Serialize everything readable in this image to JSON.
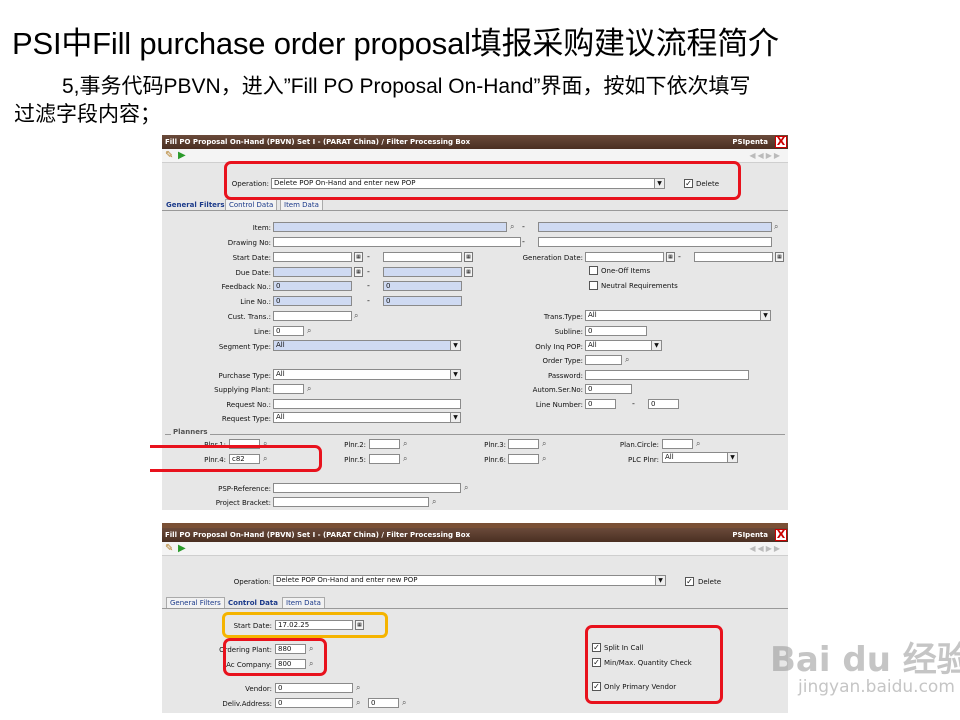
{
  "slide": {
    "title": "PSI中Fill purchase order proposal填报采购建议流程简介",
    "line1": "5,事务代码PBVN，进入”Fill PO Proposal On-Hand”界面，按如下依次填写",
    "line2": "过滤字段内容；"
  },
  "colors": {
    "titlebar": "#5a3a2a",
    "highlight_red": "#e8121d",
    "highlight_orange": "#f5b400",
    "field_blue": "#cfdaf2",
    "tab_text": "#1b3a8a"
  },
  "icons": {
    "wand": "magic-wand-icon",
    "run": "execute-play-icon",
    "close": "close-x-icon",
    "search": "magnifier-icon",
    "calendar": "calendar-icon"
  },
  "window": {
    "title": "Fill PO Proposal On-Hand  (PBVN)  Set I - (PARAT China) / Filter Processing Box",
    "brand": "PSIpenta",
    "close": "X"
  },
  "screen1": {
    "operation_label": "Operation:",
    "operation_value": "Delete POP On-Hand and enter new POP",
    "delete_label": "Delete",
    "delete_checked": true,
    "tabs": [
      "General Filters",
      "Control Data",
      "Item Data"
    ],
    "left": {
      "item": "Item:",
      "drawing_no": "Drawing No:",
      "start_date": "Start Date:",
      "due_date": "Due Date:",
      "feedback_no": "Feedback No.:",
      "feedback_from": "0",
      "feedback_to": "0",
      "line_no": "Line No.:",
      "line_from": "0",
      "line_to": "0",
      "cust_trans": "Cust. Trans.:",
      "line": "Line:",
      "line_value": "0",
      "segment_type": "Segment Type:",
      "segment_value": "All",
      "purchase_type": "Purchase Type:",
      "purchase_value": "All",
      "supplying_plant": "Supplying Plant:",
      "request_no": "Request No.:",
      "request_type": "Request Type:",
      "request_type_value": "All"
    },
    "right": {
      "generation_date": "Generation Date:",
      "one_off": "One-Off Items",
      "neutral": "Neutral Requirements",
      "trans_type": "Trans.Type:",
      "trans_type_value": "All",
      "subline": "Subline:",
      "subline_value": "0",
      "only_inq": "Only Inq POP:",
      "only_inq_value": "All",
      "order_type": "Order Type:",
      "password": "Password:",
      "autom_ser": "Autom.Ser.No:",
      "autom_ser_value": "0",
      "line_number": "Line Number:",
      "line_number_from": "0",
      "line_number_to": "0"
    },
    "planners": {
      "legend": "Planners",
      "plnr1": "Plnr.1:",
      "plnr2": "Plnr.2:",
      "plnr3": "Plnr.3:",
      "plnr4": "Plnr.4:",
      "plnr4_value": "c82",
      "plnr5": "Plnr.5:",
      "plnr6": "Plnr.6:",
      "plan_circle": "Plan.Circle:",
      "plc_plnr": "PLC Plnr:",
      "plc_value": "All"
    },
    "psp_reference": "PSP-Reference:",
    "project_bracket": "Project Bracket:"
  },
  "screen2": {
    "operation_label": "Operation:",
    "operation_value": "Delete POP On-Hand and enter new POP",
    "delete_label": "Delete",
    "tabs": [
      "General Filters",
      "Control Data",
      "Item Data"
    ],
    "start_date_label": "Start Date:",
    "start_date_value": "17.02.25",
    "ordering_plant_label": "Ordering Plant:",
    "ordering_plant_value": "880",
    "ac_company_label": "iAc Company:",
    "ac_company_value": "800",
    "vendor_label": "Vendor:",
    "vendor_value": "0",
    "deliv_label": "Deliv.Address:",
    "deliv_value": "0",
    "deliv_value2": "0",
    "split_in_call": "Split In Call",
    "minmax": "Min/Max. Quantity Check",
    "only_primary": "Only Primary Vendor"
  },
  "watermark": {
    "main": "Bai du 经验",
    "sub": "jingyan.baidu.com"
  }
}
